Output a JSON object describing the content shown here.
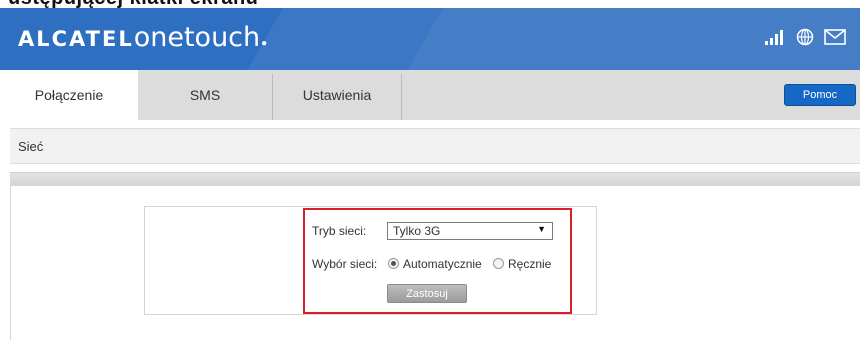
{
  "caption_fragment": "ustępującej klatki ekranu",
  "brand": {
    "name": "ALCATEL",
    "sub": "onetouch"
  },
  "status_icons": [
    "signal-icon",
    "globe-icon",
    "mail-icon"
  ],
  "nav": {
    "tabs": [
      {
        "label": "Połączenie",
        "active": true
      },
      {
        "label": "SMS",
        "active": false
      },
      {
        "label": "Ustawienia",
        "active": false
      }
    ],
    "help_label": "Pomoc"
  },
  "section": {
    "title": "Sieć"
  },
  "form": {
    "mode_label": "Tryb sieci:",
    "mode_value": "Tylko 3G",
    "selection_label": "Wybór sieci:",
    "auto_label": "Automatycznie",
    "manual_label": "Ręcznie",
    "selected": "auto",
    "apply_label": "Zastosuj"
  },
  "colors": {
    "header_blue": "#2f6fc2",
    "help_button": "#1568c6",
    "highlight_red": "#d6202a"
  }
}
